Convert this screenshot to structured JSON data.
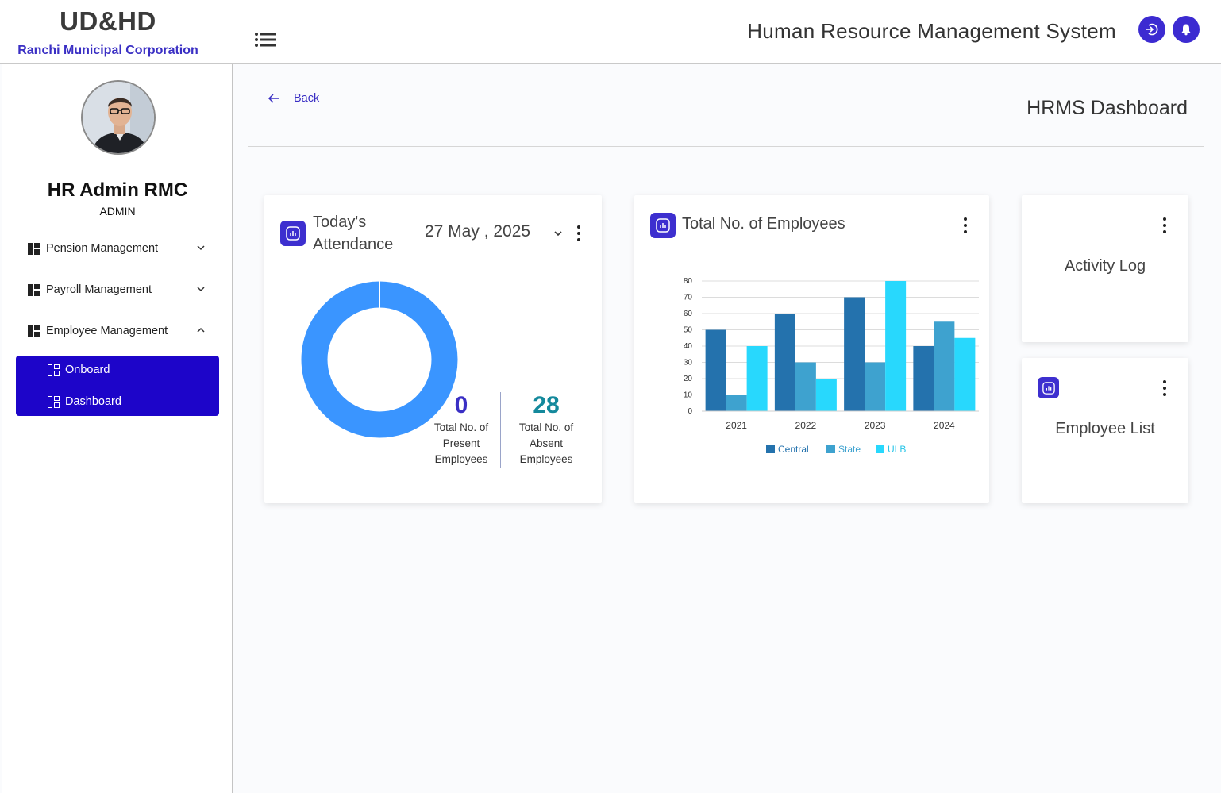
{
  "header": {
    "brand_title": "UD&HD",
    "brand_subtitle": "Ranchi Municipal Corporation",
    "system_title": "Human Resource Management System",
    "menu_icon": "list-icon",
    "logout_icon": "logout-icon",
    "bell_icon": "bell-icon"
  },
  "sidebar": {
    "user_name": "HR Admin RMC",
    "user_role": "ADMIN",
    "items": [
      {
        "label": "Pension Management",
        "expanded": false
      },
      {
        "label": "Payroll Management",
        "expanded": false
      },
      {
        "label": "Employee Management",
        "expanded": true
      }
    ],
    "subitems": [
      {
        "label": "Onboard"
      },
      {
        "label": "Dashboard"
      }
    ]
  },
  "main": {
    "back_label": "Back",
    "page_title": "HRMS Dashboard"
  },
  "attendance": {
    "title": "Today's Attendance",
    "date": "27 May , 2025",
    "present_count": "0",
    "present_label": "Total No. of Present Employees",
    "absent_count": "28",
    "absent_label": "Total No. of Absent Employees"
  },
  "employees_card": {
    "title": "Total No. of Employees"
  },
  "activity_log": {
    "title": "Activity Log"
  },
  "employee_list": {
    "title": "Employee List"
  },
  "colors": {
    "accent": "#3c2bd1",
    "submenu_bg": "#1d05c9",
    "donut": "#3a95ff",
    "present": "#3a2fc4",
    "absent": "#14899c",
    "central": "#2472ad",
    "state": "#3ea2cf",
    "ulb": "#28d8fd"
  },
  "chart_data": [
    {
      "type": "pie",
      "values": [
        0,
        28
      ],
      "categories": [
        "Present",
        "Absent"
      ]
    },
    {
      "type": "bar",
      "categories": [
        "2021",
        "2022",
        "2023",
        "2024"
      ],
      "series": [
        {
          "name": "Central",
          "values": [
            50,
            60,
            70,
            40
          ]
        },
        {
          "name": "State",
          "values": [
            10,
            30,
            30,
            55
          ]
        },
        {
          "name": "ULB",
          "values": [
            40,
            20,
            80,
            45
          ]
        }
      ],
      "ylim": [
        0,
        80
      ],
      "yticks": [
        0,
        10,
        20,
        30,
        40,
        50,
        60,
        70,
        80
      ],
      "grid": true,
      "legend": "bottom"
    }
  ]
}
